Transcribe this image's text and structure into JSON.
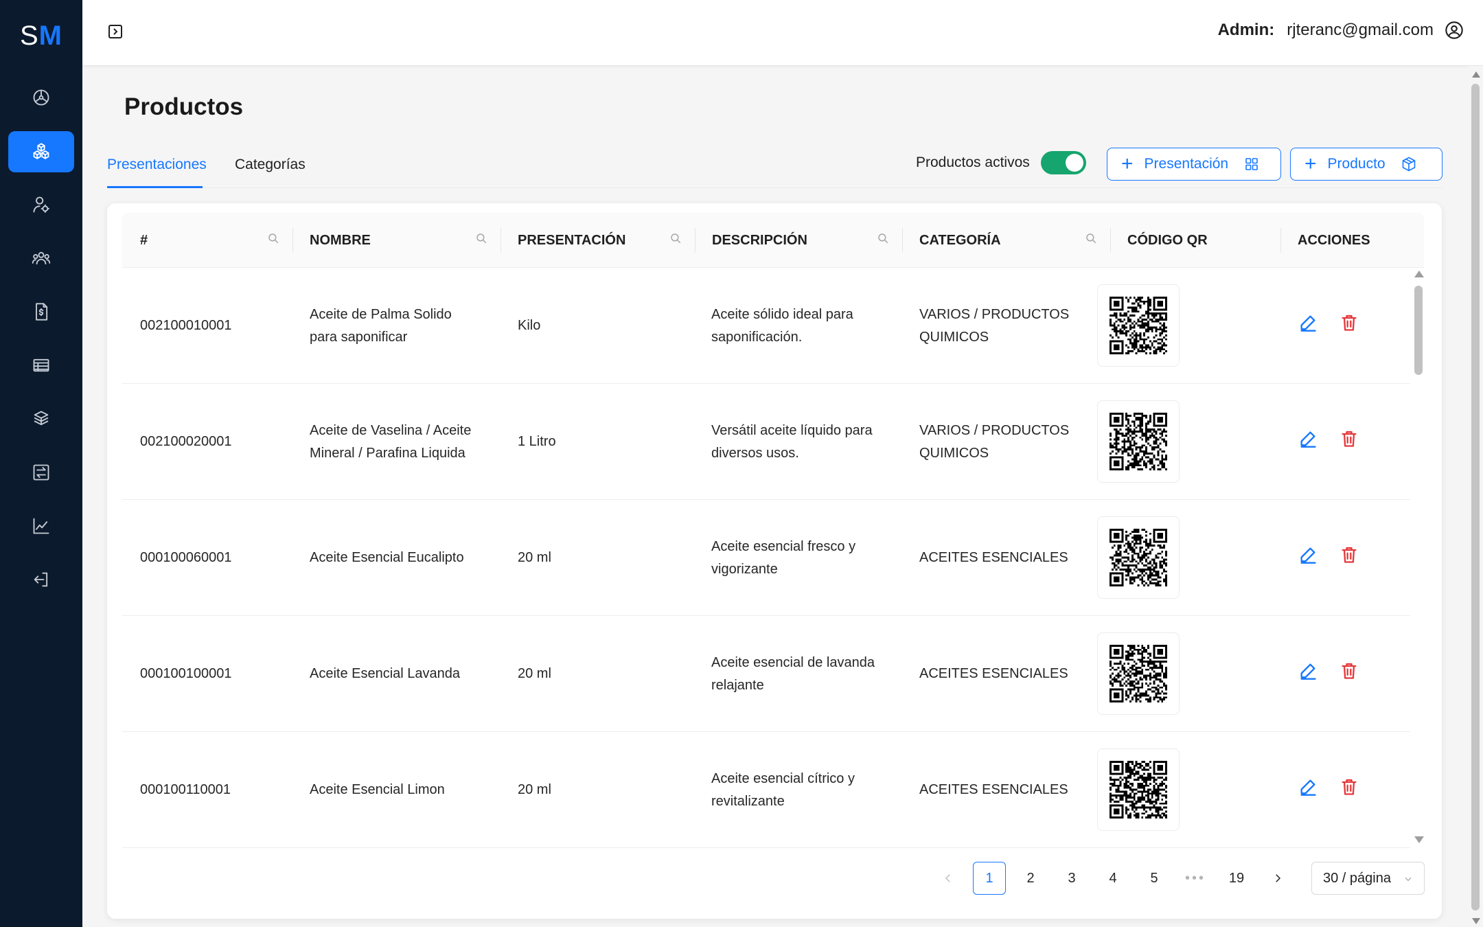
{
  "app": {
    "logo_s": "S",
    "logo_m": "M",
    "accent_color": "#1677ff",
    "sidebar_color": "#0c1a2d"
  },
  "sidebar": {
    "items": [
      {
        "icon": "dashboard-icon",
        "active": false
      },
      {
        "icon": "products-cubes-icon",
        "active": true
      },
      {
        "icon": "user-settings-icon",
        "active": false
      },
      {
        "icon": "users-group-icon",
        "active": false
      },
      {
        "icon": "invoice-dollar-icon",
        "active": false
      },
      {
        "icon": "table-list-icon",
        "active": false
      },
      {
        "icon": "boxes-stack-icon",
        "active": false
      },
      {
        "icon": "transfer-box-icon",
        "active": false
      },
      {
        "icon": "chart-line-icon",
        "active": false
      },
      {
        "icon": "logout-icon",
        "active": false
      }
    ]
  },
  "header": {
    "role_label": "Admin:",
    "email": "rjteranc@gmail.com"
  },
  "page": {
    "title": "Productos",
    "tabs": [
      {
        "label": "Presentaciones",
        "active": true
      },
      {
        "label": "Categorías",
        "active": false
      }
    ],
    "toggle_label": "Productos activos",
    "toggle_on": true,
    "buttons": {
      "presentacion": "Presentación",
      "producto": "Producto"
    }
  },
  "table": {
    "columns": [
      "#",
      "NOMBRE",
      "PRESENTACIÓN",
      "DESCRIPCIÓN",
      "CATEGORÍA",
      "CÓDIGO QR",
      "ACCIONES"
    ],
    "rows": [
      {
        "id": "002100010001",
        "nombre_1": "Aceite de Palma Solido",
        "nombre_2": "para saponificar",
        "presentacion": "Kilo",
        "desc_1": "Aceite sólido ideal para",
        "desc_2": "saponificación.",
        "cat_1": "VARIOS / PRODUCTOS",
        "cat_2": "QUIMICOS"
      },
      {
        "id": "002100020001",
        "nombre_1": "Aceite de Vaselina / Aceite",
        "nombre_2": "Mineral / Parafina Liquida",
        "presentacion": "1 Litro",
        "desc_1": "Versátil aceite líquido para",
        "desc_2": "diversos usos.",
        "cat_1": "VARIOS / PRODUCTOS",
        "cat_2": "QUIMICOS"
      },
      {
        "id": "000100060001",
        "nombre_1": "Aceite Esencial Eucalipto",
        "nombre_2": "",
        "presentacion": "20 ml",
        "desc_1": "Aceite esencial fresco y",
        "desc_2": "vigorizante",
        "cat_1": "ACEITES ESENCIALES",
        "cat_2": ""
      },
      {
        "id": "000100100001",
        "nombre_1": "Aceite Esencial Lavanda",
        "nombre_2": "",
        "presentacion": "20 ml",
        "desc_1": "Aceite esencial de lavanda",
        "desc_2": "relajante",
        "cat_1": "ACEITES ESENCIALES",
        "cat_2": ""
      },
      {
        "id": "000100110001",
        "nombre_1": "Aceite Esencial Limon",
        "nombre_2": "",
        "presentacion": "20 ml",
        "desc_1": "Aceite esencial cítrico y",
        "desc_2": "revitalizante",
        "cat_1": "ACEITES ESENCIALES",
        "cat_2": ""
      }
    ]
  },
  "pagination": {
    "pages": [
      "1",
      "2",
      "3",
      "4",
      "5"
    ],
    "ellipsis": "•••",
    "last_page": "19",
    "current": "1",
    "page_size": "30 / página"
  }
}
